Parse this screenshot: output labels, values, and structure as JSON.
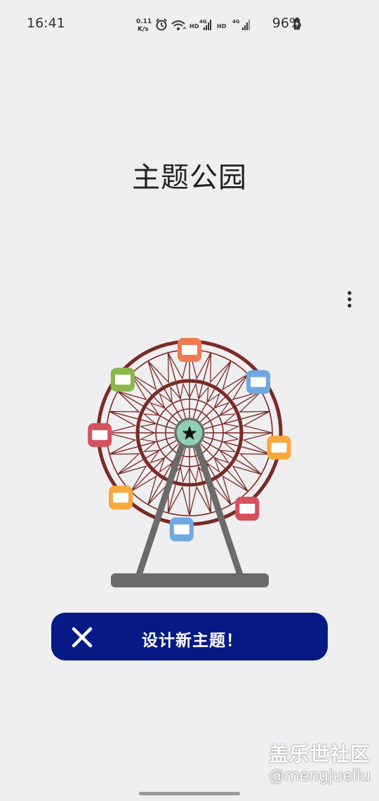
{
  "status_bar": {
    "time": "16:41",
    "network_speed_value": "0.11",
    "network_speed_unit": "K/s",
    "signal1_tag": "HD",
    "signal1_gen": "4G",
    "signal2_tag": "HD",
    "signal2_gen": "4G",
    "battery": "96%",
    "icons": [
      "alarm-icon",
      "wifi-icon",
      "signal-icon",
      "signal-icon",
      "battery-charging-icon"
    ]
  },
  "page": {
    "title": "主题公园"
  },
  "menu": {
    "icon": "more-vertical-icon"
  },
  "illustration": {
    "name": "ferris-wheel",
    "colors": {
      "frame": "#7b2a24",
      "hub": "#8fd0b0",
      "stand": "#6b6b6b",
      "cabins": [
        "#f07b52",
        "#6fa8e0",
        "#f7a93b",
        "#d4525e",
        "#6fa8e0",
        "#f7a93b",
        "#d4525e",
        "#8bb84a"
      ]
    }
  },
  "action_button": {
    "label": "设计新主题！",
    "icon": "close-icon",
    "color": "#051a85"
  },
  "watermark": {
    "line1": "盖乐世社区",
    "line2": "@mengjueliu"
  }
}
